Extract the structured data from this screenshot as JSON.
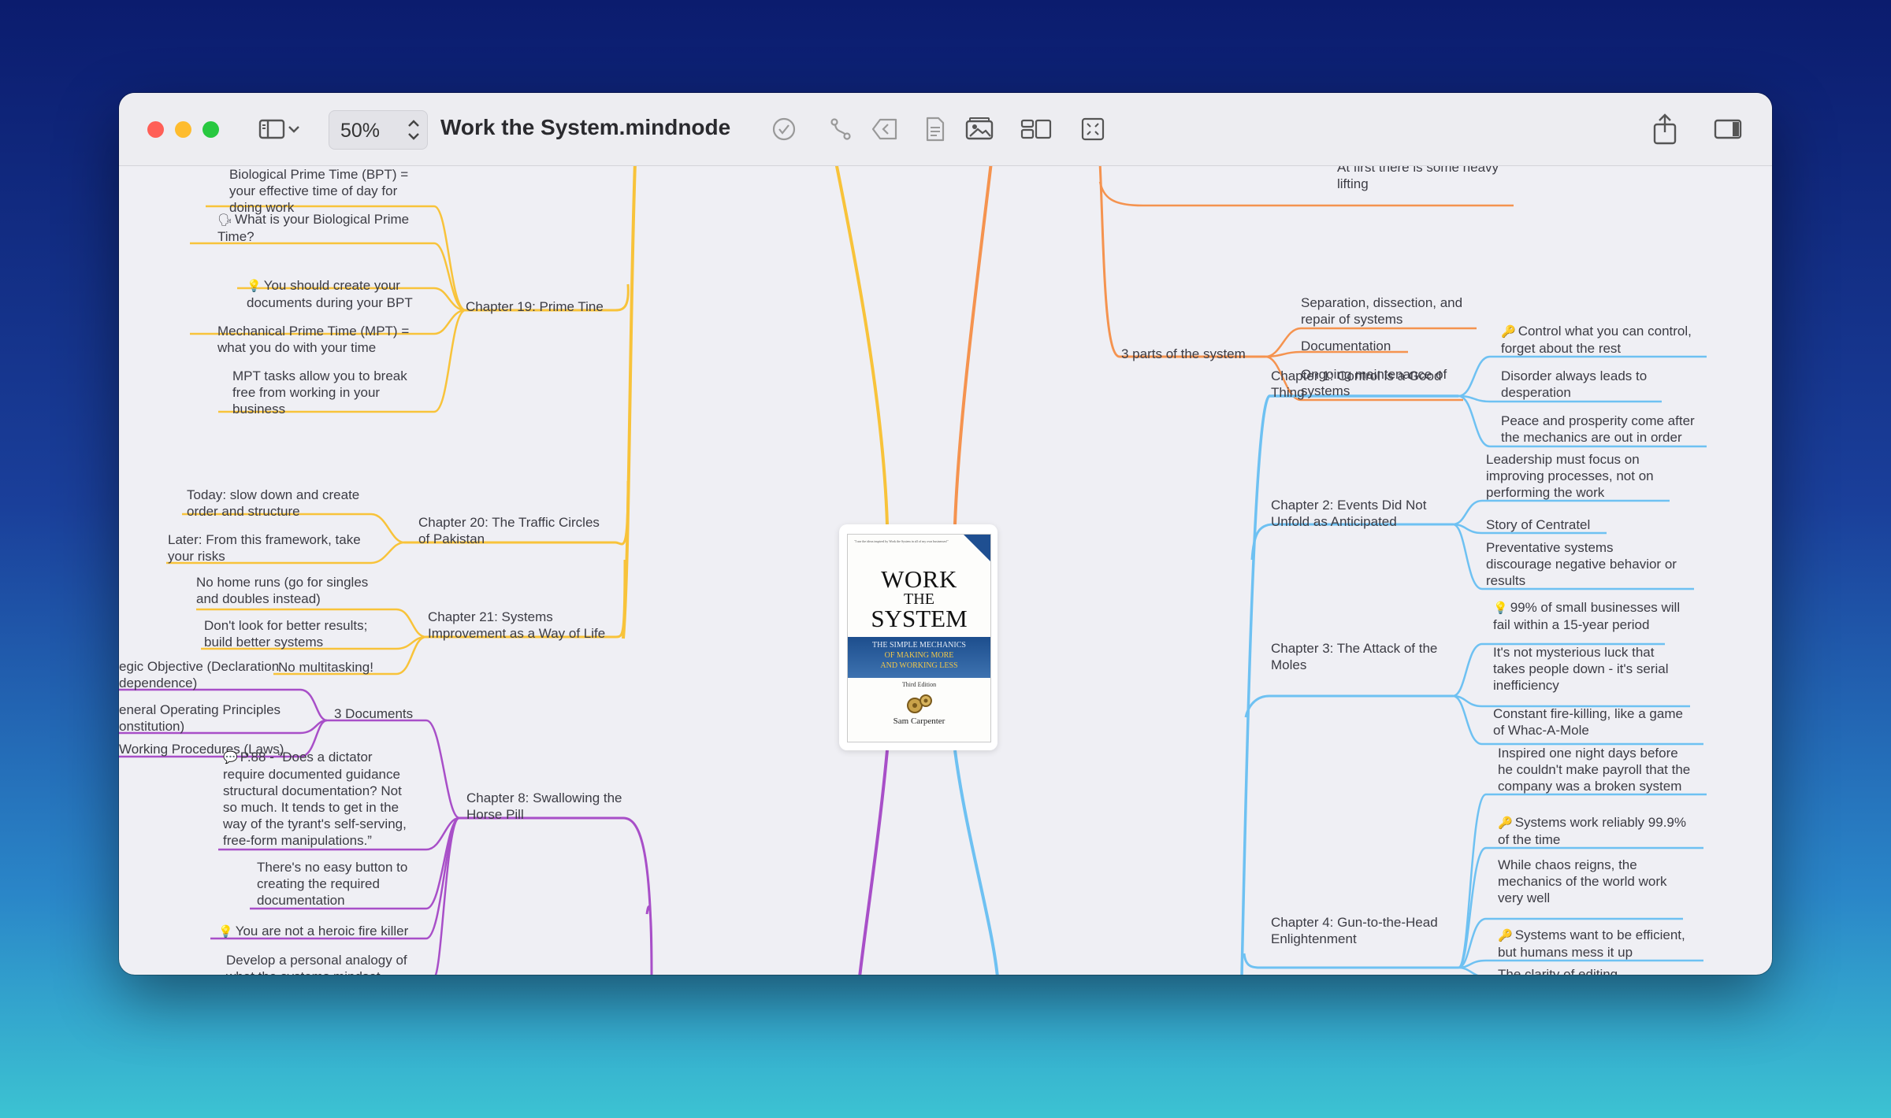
{
  "window": {
    "title": "Work the System.mindnode",
    "zoom": "50%"
  },
  "toolbar": {
    "icons": [
      "sidebar-icon",
      "chevron-down-icon",
      "checkmark-circle-icon",
      "connection-icon",
      "back-icon",
      "note-icon",
      "media-icon",
      "layout-icon",
      "focus-icon",
      "share-icon",
      "inspector-icon"
    ]
  },
  "central": {
    "cover_quote": "\"I use the ideas inspired by Work the System in all of my own businesses!\"",
    "cover_title_1": "WORK",
    "cover_title_2": "THE",
    "cover_title_3": "SYSTEM",
    "cover_subtitle_1": "THE SIMPLE MECHANICS",
    "cover_subtitle_2": "OF MAKING MORE",
    "cover_subtitle_3": "AND WORKING LESS",
    "cover_edition": "Third Edition",
    "cover_author": "Sam Carpenter"
  },
  "colors": {
    "yellow": "#f8c33a",
    "orange": "#f5934f",
    "purple": "#a84fc8",
    "blue": "#6ec1f2"
  },
  "left_top": {
    "ch19": {
      "label": "Chapter 19: Prime Tine",
      "items": [
        "Biological Prime Time (BPT) =\nyour effective time of day for\ndoing work",
        "What is your Biological Prime\nTime?",
        "You should create your\ndocuments during your BPT",
        "Mechanical Prime Time (MPT) =\nwhat you do with your time",
        "MPT tasks allow you to break\nfree from working in your\nbusiness"
      ]
    },
    "ch20": {
      "label": "Chapter 20: The Traffic Circles\nof Pakistan",
      "items": [
        "Today: slow down and create\norder and structure",
        "Later: From this framework, take\nyour risks"
      ]
    },
    "ch21": {
      "label": "Chapter 21: Systems\nImprovement as a Way of Life",
      "items": [
        "No home runs (go for singles\nand doubles instead)",
        "Don't look for better results;\nbuild better systems",
        "No multitasking!"
      ]
    }
  },
  "left_bottom": {
    "docs": {
      "label": "3 Documents",
      "items": [
        "egic Objective (Declaration\ndependence)",
        "eneral Operating Principles\nonstitution)",
        "Working Procedures (Laws)"
      ]
    },
    "ch8": {
      "label": "Chapter 8: Swallowing the\nHorse Pill",
      "items": [
        "P.88 - “Does a dictator\nrequire documented guidance\nstructural documentation? Not\nso much. It tends to get in the\nway of the tyrant's self-serving,\nfree-form manipulations.”",
        "There's no easy button to\ncreating the required\ndocumentation",
        "You are not a heroic fire killer",
        "Develop a personal analogy of\nwhat the systems mindset"
      ]
    }
  },
  "right_top": {
    "partial": "At first there is some heavy\nlifting",
    "parts": {
      "label": "3 parts of the system",
      "items": [
        "Separation, dissection, and\nrepair of systems",
        "Documentation",
        "Ongoing maintenance of\nsystems"
      ]
    }
  },
  "right_bottom": {
    "ch1": {
      "label": "Chapter 1: Control is a Good\nThing",
      "items": [
        "Control what you can control,\nforget about the rest",
        "Disorder always leads to\ndesperation",
        "Peace and prosperity come after\nthe mechanics are out in order"
      ]
    },
    "ch2": {
      "label": "Chapter 2: Events Did Not\nUnfold as Anticipated",
      "items": [
        "Leadership must focus on\nimproving processes, not on\nperforming the work",
        "Story of Centratel",
        "Preventative systems\ndiscourage negative behavior or\nresults"
      ]
    },
    "ch3": {
      "label": "Chapter 3: The Attack of the\nMoles",
      "items": [
        "99% of small businesses will\nfail within a 15-year period",
        "It's not mysterious luck that\ntakes people down - it's serial\ninefficiency",
        "Constant fire-killing, like a game\nof Whac-A-Mole"
      ]
    },
    "ch4": {
      "label": "Chapter 4: Gun-to-the-Head\nEnlightenment",
      "items": [
        "Inspired one night days before\nhe couldn't make payroll that the\ncompany was a broken system",
        "Systems work reliably 99.9%\nof the time",
        "While chaos reigns, the\nmechanics of the world work\nvery well",
        "Systems want to be efficient,\nbut humans mess it up",
        "The clarity of editing..."
      ]
    }
  }
}
